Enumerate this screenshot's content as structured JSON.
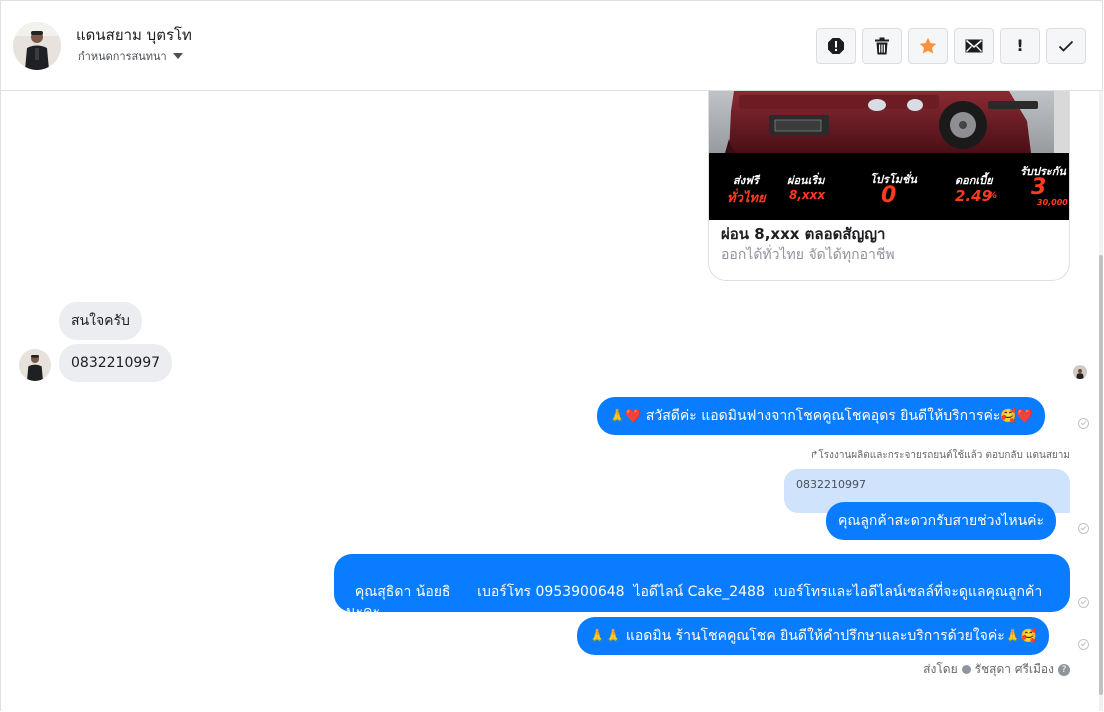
{
  "header": {
    "contact_name": "แดนสยาม บุตรโท",
    "subtitle": "กำหนดการสนทนา"
  },
  "toolbar": {
    "icons": [
      "alert-circle-icon",
      "trash-icon",
      "star-icon",
      "envelope-icon",
      "exclamation-icon",
      "checkmark-icon"
    ],
    "exclamation_label": "!",
    "star_color": "#f7923a"
  },
  "card": {
    "promo": {
      "free_shipping": "ส่งฟรี",
      "nationwide": "ทั่วไทย",
      "installment_start": "ผ่อนเริ่ม",
      "installment_value": "8,xxx",
      "promotion": "โปรโมชั่น",
      "down": "0",
      "interest": "ดอกเบี้ย",
      "interest_value": "2.49",
      "interest_unit": "%",
      "insurance": "รับประกัน",
      "insurance_value": "3",
      "insurance_km": "30,000"
    },
    "title": "ผ่อน 8,xxx ตลอดสัญญา",
    "subtitle": "ออกได้ทั่วไทย จัดได้ทุกอาชีพ"
  },
  "incoming": [
    {
      "text": "สนใจครับ"
    },
    {
      "text": "0832210997"
    }
  ],
  "outgoing": [
    {
      "text": "สวัสดีค่ะ แอดมินฟางจากโชคคูณโชคอุดร ยินดีให้บริการค่ะ",
      "prefix": "🙏❤️",
      "suffix": "🥰❤️"
    },
    {
      "text": "คุณลูกค้าสะดวกรับสายช่วงไหนค่ะ"
    },
    {
      "text": "คุณสุธิดา น้อยธิ      เบอร์โทร 0953900648  ไอดีไลน์ Cake_2488  เบอร์โทรและไอดีไลน์เซลล์ที่จะดูแลคุณลูกค้านะคะ"
    },
    {
      "text": "แอดมิน ร้านโชคคูณโชค ยินดีให้คำปรึกษาและบริการด้วยใจค่ะ",
      "prefix": "🙏🙏",
      "suffix": "🙏🥰"
    }
  ],
  "reply_note": "↱โรงงานผลิตและกระจายรถยนต์ใช้แล้ว ตอบกลับ แดนสยาม",
  "quoted_text": "0832210997",
  "sent_by": {
    "label": "ส่งโดย",
    "name": "รัชสุดา ศรีเมือง",
    "help": "?"
  },
  "colors": {
    "outgoing_bubble": "#0a7cff",
    "incoming_bubble": "#ebedf0",
    "quoted_bubble": "#cfe3fd",
    "promo_accent": "#ff3a1f"
  }
}
